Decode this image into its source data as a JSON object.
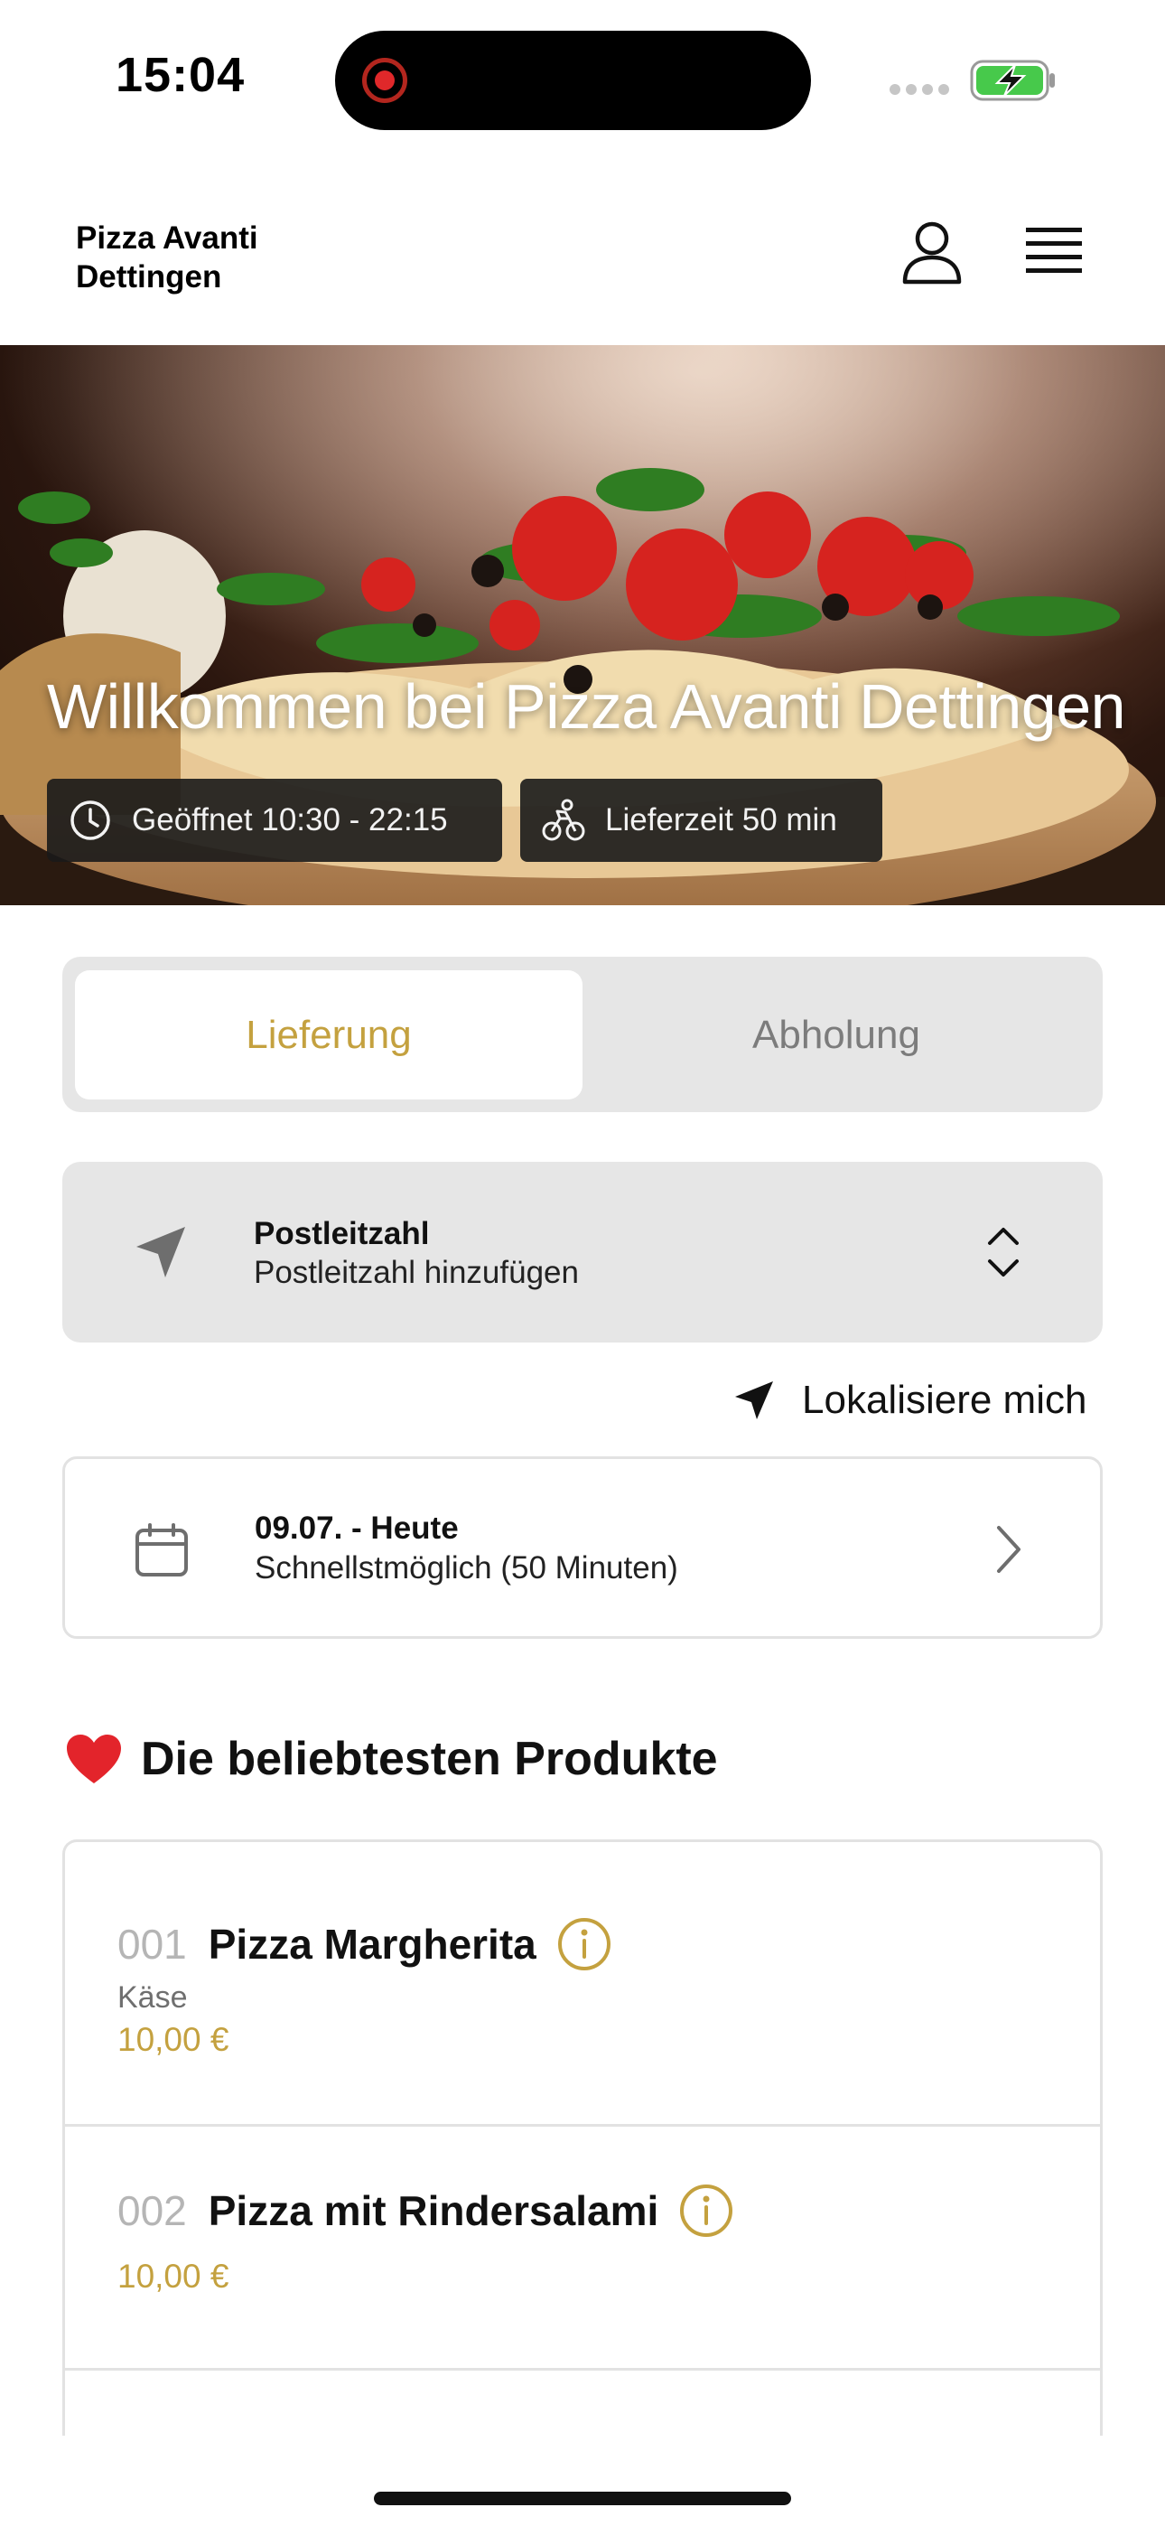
{
  "status_bar": {
    "time": "15:04"
  },
  "header": {
    "brand": "Pizza Avanti Dettingen"
  },
  "hero": {
    "title": "Willkommen bei Pizza Avanti Dettingen",
    "opening_hours": "Geöffnet 10:30 - 22:15",
    "delivery_time": "Lieferzeit 50 min"
  },
  "order_mode": {
    "tabs": [
      {
        "label": "Lieferung",
        "active": true
      },
      {
        "label": "Abholung",
        "active": false
      }
    ]
  },
  "postcode": {
    "title": "Postleitzahl",
    "placeholder": "Postleitzahl hinzufügen"
  },
  "locate": {
    "label": "Lokalisiere mich"
  },
  "schedule": {
    "title": "09.07. - Heute",
    "subtitle": "Schnellstmöglich (50 Minuten)"
  },
  "popular": {
    "heading": "Die beliebtesten Produkte",
    "products": [
      {
        "number": "001",
        "name": "Pizza Margherita",
        "description": "Käse",
        "price": "10,00 €"
      },
      {
        "number": "002",
        "name": "Pizza mit Rindersalami",
        "description": "",
        "price": "10,00 €"
      }
    ]
  },
  "colors": {
    "accent": "#c4a13f",
    "panel": "#e6e6e6",
    "border": "#e2e2e2",
    "heart": "#e3242b"
  }
}
